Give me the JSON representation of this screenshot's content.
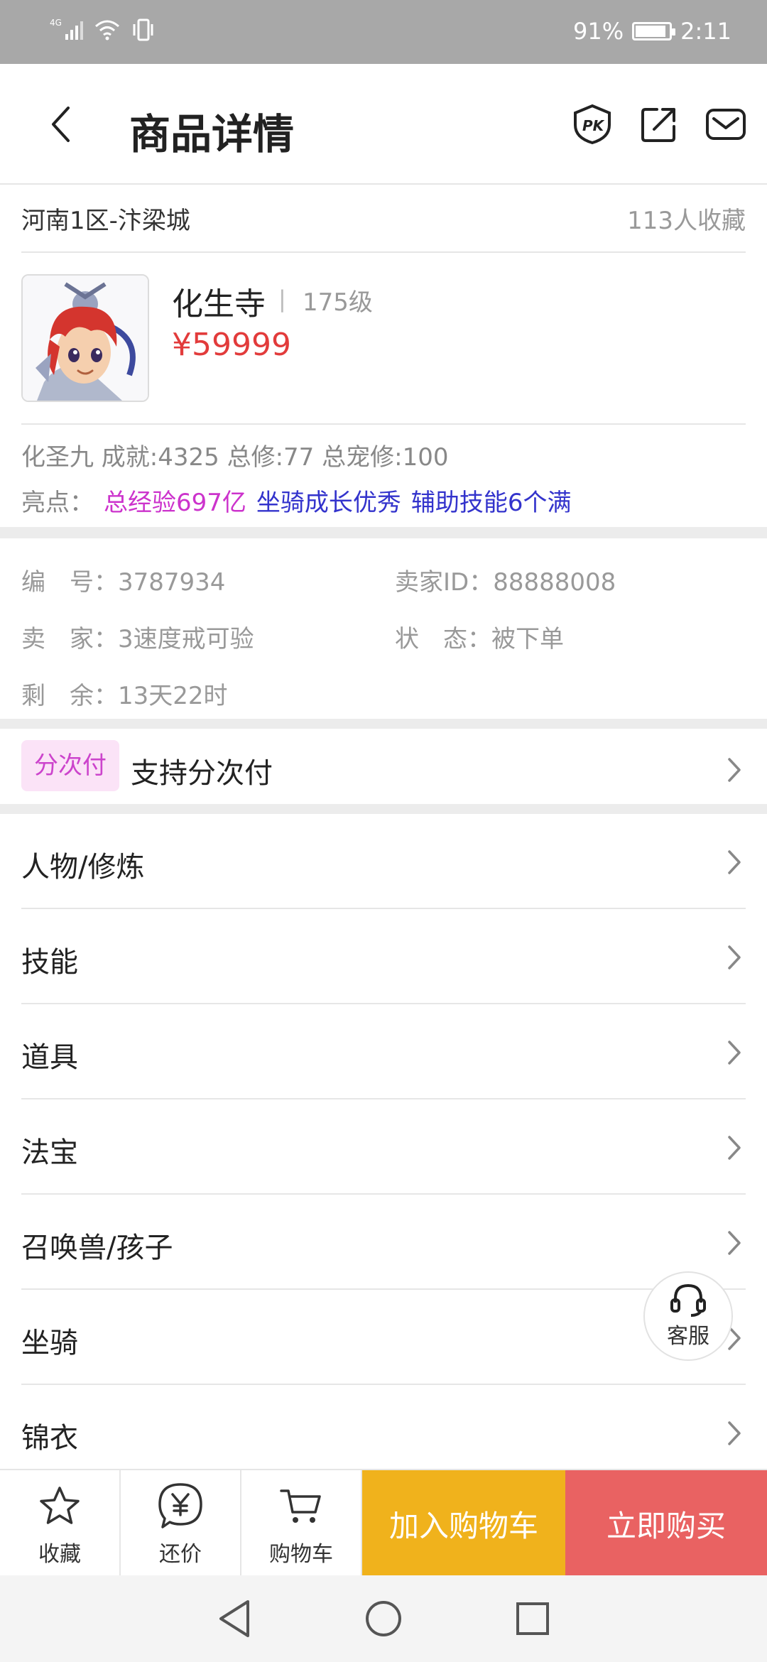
{
  "status_bar": {
    "network": "4G",
    "battery": "91%",
    "battery_level": 0.91,
    "time": "2:11"
  },
  "header": {
    "title": "商品详情",
    "icons": [
      "pk-shield-icon",
      "share-icon",
      "message-icon"
    ]
  },
  "listing": {
    "region": "河南1区-汴梁城",
    "favorites": "113人收藏"
  },
  "product": {
    "name": "化生寺",
    "separator": "|",
    "level": "175级",
    "price": "¥59999",
    "stats": "化圣九 成就:4325 总修:77 总宠修:100",
    "highlights_label": "亮点：",
    "highlights": [
      "总经验697亿",
      "坐骑成长优秀",
      "辅助技能6个满"
    ]
  },
  "info": {
    "id_label": "编　号：",
    "id_value": "3787934",
    "seller_id_label": "卖家ID：",
    "seller_id_value": "88888008",
    "seller_label": "卖　家：",
    "seller_value": "3速度戒可验",
    "status_label": "状　态：",
    "status_value": "被下单",
    "remaining_label": "剩　余：",
    "remaining_value": "13天22时"
  },
  "installment": {
    "badge": "分次付",
    "text": "支持分次付"
  },
  "sections": [
    "人物/修炼",
    "技能",
    "道具",
    "法宝",
    "召唤兽/孩子",
    "坐骑",
    "锦衣"
  ],
  "customer_service": {
    "label": "客服"
  },
  "bottom_bar": {
    "favorite": "收藏",
    "bargain": "还价",
    "cart": "购物车",
    "add_to_cart": "加入购物车",
    "buy_now": "立即购买"
  },
  "colors": {
    "price": "#e23b3b",
    "highlight_primary": "#cc33cc",
    "highlight_secondary": "#3333cc",
    "add_to_cart": "#f0b21c",
    "buy_now": "#e96262"
  }
}
